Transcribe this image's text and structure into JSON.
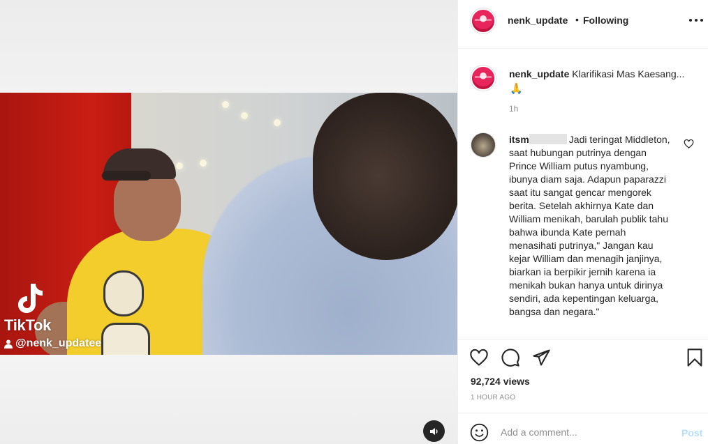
{
  "post": {
    "username": "nenk_update",
    "follow_separator": "•",
    "follow_status": "Following",
    "more_icon": "more-horizontal-icon",
    "caption_text": "Klarifikasi Mas Kaesang...",
    "caption_emoji": "🙏",
    "caption_time": "1h",
    "views": "92,724 views",
    "age": "1 HOUR AGO"
  },
  "video": {
    "watermark_brand": "TikTok",
    "watermark_handle": "@nenk_updatee",
    "sound_icon": "speaker-icon"
  },
  "comment": {
    "username_prefix": "itsm",
    "text": "Jadi teringat Middleton, saat hubungan putrinya dengan Prince William putus nyambung, ibunya diam saja. Adapun paparazzi saat itu sangat gencar mengorek berita. Setelah akhirnya Kate dan William menikah, barulah publik tahu bahwa ibunda Kate pernah menasihati putrinya,\" Jangan kau kejar William dan menagih janjinya, biarkan ia berpikir jernih karena ia menikah bukan hanya untuk dirinya sendiri, ada kepentingan keluarga, bangsa dan negara.\""
  },
  "actions": {
    "icons": [
      "heart-icon",
      "comment-icon",
      "share-icon",
      "bookmark-icon"
    ]
  },
  "add_comment": {
    "placeholder": "Add a comment...",
    "post_label": "Post",
    "emoji_icon": "smiley-icon"
  },
  "colors": {
    "link_disabled": "#b2dffc",
    "text_primary": "#262626",
    "text_secondary": "#8e8e8e"
  }
}
